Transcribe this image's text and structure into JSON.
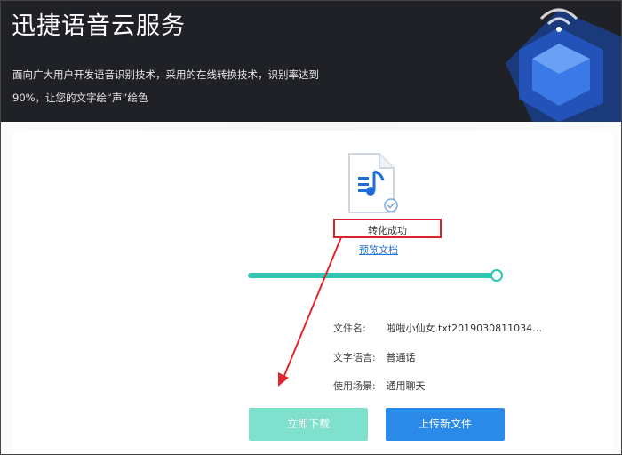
{
  "banner": {
    "title": "迅捷语音云服务",
    "description": "面向广大用户开发语音识别技术，采用的在线转换技术，识别率达到90%，让您的文字绘“声”绘色"
  },
  "file": {
    "icon": "audio-file-icon",
    "status": "转化成功",
    "preview_link": "预览文档"
  },
  "progress": {
    "value": 1.0
  },
  "info": {
    "filename_label": "文件名:",
    "filename_value": "啦啦小仙女.txt2019030811034…",
    "language_label": "文字语言:",
    "language_value": "普通话",
    "scene_label": "使用场景:",
    "scene_value": "通用聊天"
  },
  "buttons": {
    "download": "立即下载",
    "upload": "上传新文件"
  },
  "colors": {
    "banner_bg": "#1f2126",
    "accent_teal": "#2ec7b5",
    "download_btn": "#7ee0cd",
    "upload_btn": "#2b8ae8",
    "highlight_red": "#d9232b"
  }
}
